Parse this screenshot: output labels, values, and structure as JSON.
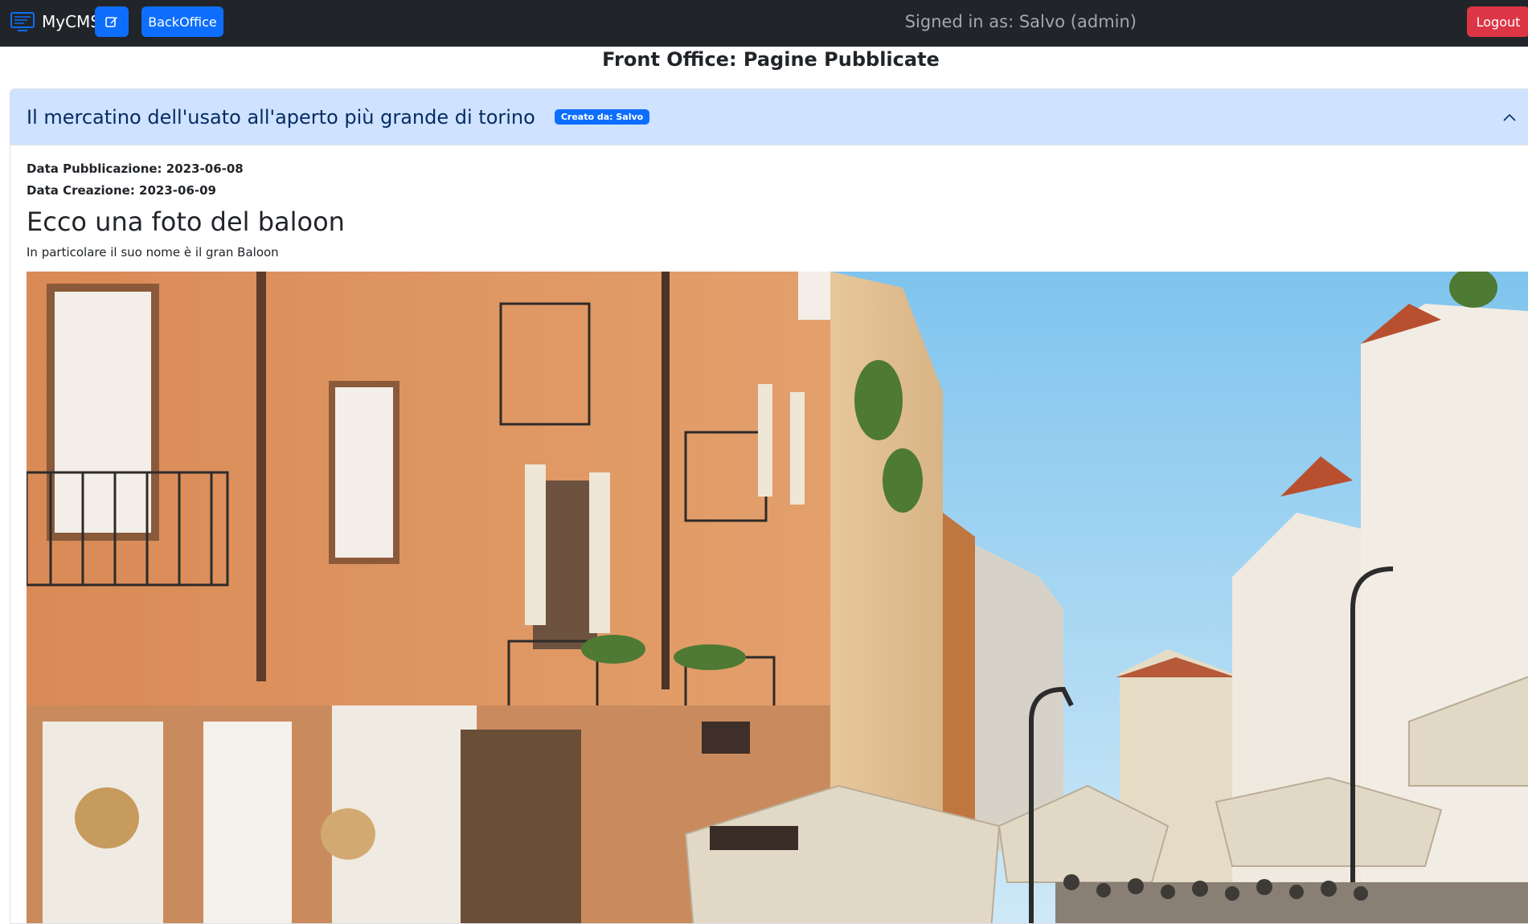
{
  "navbar": {
    "brand": "MyCMS",
    "backoffice_label": "BackOffice",
    "signed_in_text": "Signed in as: Salvo (admin)",
    "logout_label": "Logout",
    "icons": {
      "brand": "monitor-icon",
      "edit": "pencil-square-icon"
    },
    "colors": {
      "bg": "#212529",
      "primary": "#0d6efd",
      "danger": "#dc3545"
    }
  },
  "page": {
    "title": "Front Office: Pagine Pubblicate"
  },
  "article": {
    "title": "Il mercatino dell'usato all'aperto più grande di torino",
    "badge": "Creato da: Salvo",
    "pub_date_label": "Data Pubblicazione: 2023-06-08",
    "created_date_label": "Data Creazione: 2023-06-09",
    "heading": "Ecco una foto del baloon",
    "paragraph": "In particolare il suo nome è il gran Baloon",
    "chevron_icon": "chevron-up-icon",
    "header_color": "#cfe2ff"
  }
}
